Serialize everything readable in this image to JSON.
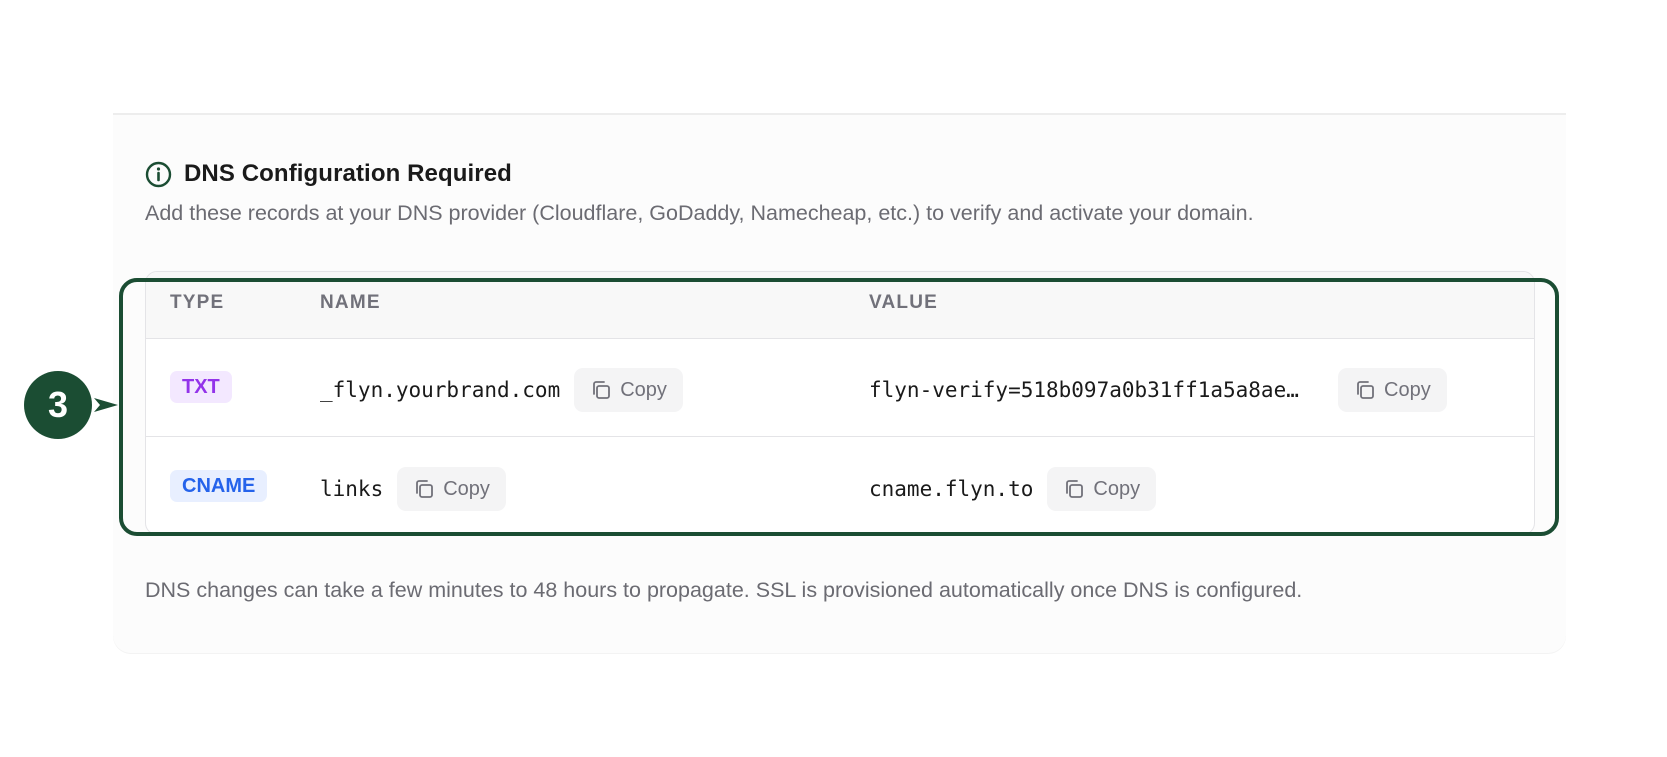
{
  "card": {
    "title": "DNS Configuration Required",
    "description": "Add these records at your DNS provider (Cloudflare, GoDaddy, Namecheap, etc.) to verify and activate your domain.",
    "footnote": "DNS changes can take a few minutes to 48 hours to propagate. SSL is provisioned automatically once DNS is configured."
  },
  "table": {
    "headers": {
      "type": "TYPE",
      "name": "NAME",
      "value": "VALUE"
    },
    "rows": [
      {
        "type": "TXT",
        "name": "_flyn.yourbrand.com",
        "value": "flyn-verify=518b097a0b31ff1a5a8ae…",
        "copy_name": "Copy",
        "copy_value": "Copy"
      },
      {
        "type": "CNAME",
        "name": "links",
        "value": "cname.flyn.to",
        "copy_name": "Copy",
        "copy_value": "Copy"
      }
    ]
  },
  "annotation": {
    "step_number": "3"
  },
  "colors": {
    "accent_dark_green": "#1b4d33",
    "txt_badge_bg": "#f3e8ff",
    "txt_badge_fg": "#9333ea",
    "cname_badge_bg": "#e8efff",
    "cname_badge_fg": "#2563eb"
  },
  "icons": {
    "header": "info-icon",
    "copy": "copy-icon"
  }
}
